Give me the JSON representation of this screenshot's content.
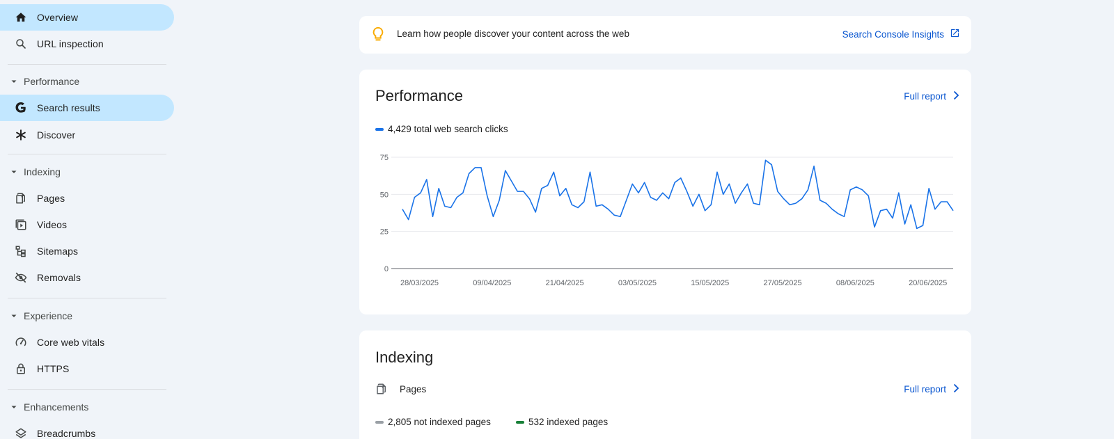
{
  "sidebar": {
    "overview": "Overview",
    "url_inspection": "URL inspection",
    "performance_section": "Performance",
    "search_results": "Search results",
    "discover": "Discover",
    "indexing_section": "Indexing",
    "pages": "Pages",
    "videos": "Videos",
    "sitemaps": "Sitemaps",
    "removals": "Removals",
    "experience_section": "Experience",
    "core_web_vitals": "Core web vitals",
    "https": "HTTPS",
    "enhancements_section": "Enhancements",
    "breadcrumbs": "Breadcrumbs"
  },
  "banner": {
    "text": "Learn how people discover your content across the web",
    "link": "Search Console Insights"
  },
  "performance": {
    "title": "Performance",
    "full_report": "Full report",
    "legend": "4,429 total web search clicks"
  },
  "indexing": {
    "title": "Indexing",
    "pages_label": "Pages",
    "full_report": "Full report",
    "legend_not_indexed": "2,805 not indexed pages",
    "legend_indexed": "532 indexed pages"
  },
  "colors": {
    "accent": "#0b57d0",
    "active_nav": "#c2e7ff",
    "series": "#1a73e8",
    "indexed": "#188038",
    "not_indexed": "#9aa0a6",
    "bulb": "#f9ab00"
  },
  "chart_data": {
    "type": "line",
    "series": [
      {
        "name": "total web search clicks",
        "values": [
          40,
          33,
          48,
          51,
          60,
          35,
          54,
          42,
          41,
          48,
          51,
          64,
          68,
          68,
          49,
          35,
          46,
          66,
          59,
          52,
          52,
          47,
          38,
          54,
          56,
          65,
          49,
          54,
          43,
          41,
          45,
          65,
          42,
          43,
          40,
          36,
          35,
          46,
          57,
          51,
          58,
          48,
          46,
          51,
          47,
          58,
          61,
          52,
          42,
          50,
          39,
          43,
          65,
          50,
          57,
          44,
          51,
          57,
          44,
          43,
          73,
          70,
          52,
          47,
          43,
          44,
          47,
          53,
          69,
          46,
          44,
          40,
          37,
          35,
          53,
          55,
          53,
          49,
          28,
          39,
          40,
          34,
          51,
          30,
          43,
          27,
          29,
          54,
          40,
          45,
          45,
          39
        ]
      }
    ],
    "x_tick_labels": [
      "28/03/2025",
      "09/04/2025",
      "21/04/2025",
      "03/05/2025",
      "15/05/2025",
      "27/05/2025",
      "08/06/2025",
      "20/06/2025"
    ],
    "x_tick_index": [
      0,
      12,
      24,
      36,
      48,
      60,
      72,
      84
    ],
    "y_ticks": [
      0,
      25,
      50,
      75
    ],
    "ylim": [
      0,
      75
    ],
    "grid": true,
    "legend": "top-left"
  }
}
